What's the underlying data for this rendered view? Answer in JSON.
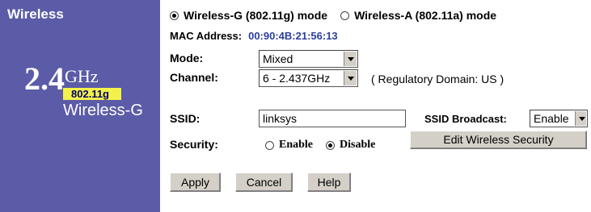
{
  "sidebar": {
    "title": "Wireless",
    "logo": {
      "number": "2.4",
      "unit": "GHz",
      "standard": "802.11g",
      "name": "Wireless-G"
    }
  },
  "mode_select": {
    "option_g": "Wireless-G (802.11g) mode",
    "option_a": "Wireless-A (802.11a) mode",
    "selected": "option_g"
  },
  "mac": {
    "label": "MAC Address:",
    "value": "00:90:4B:21:56:13"
  },
  "mode": {
    "label": "Mode:",
    "value": "Mixed"
  },
  "channel": {
    "label": "Channel:",
    "value": "6 - 2.437GHz",
    "regulatory_note": "( Regulatory Domain: US )"
  },
  "ssid": {
    "label": "SSID:",
    "value": "linksys",
    "broadcast_label": "SSID Broadcast:",
    "broadcast_value": "Enable"
  },
  "security": {
    "label": "Security:",
    "enable_label": "Enable",
    "disable_label": "Disable",
    "selected": "disable",
    "edit_button": "Edit Wireless Security"
  },
  "actions": {
    "apply": "Apply",
    "cancel": "Cancel",
    "help": "Help"
  },
  "colors": {
    "sidebar_bg": "#5b5ba8",
    "logo_band": "#f4f24a",
    "mac_value": "#2b3f9c",
    "button_face": "#d4d0c8"
  }
}
